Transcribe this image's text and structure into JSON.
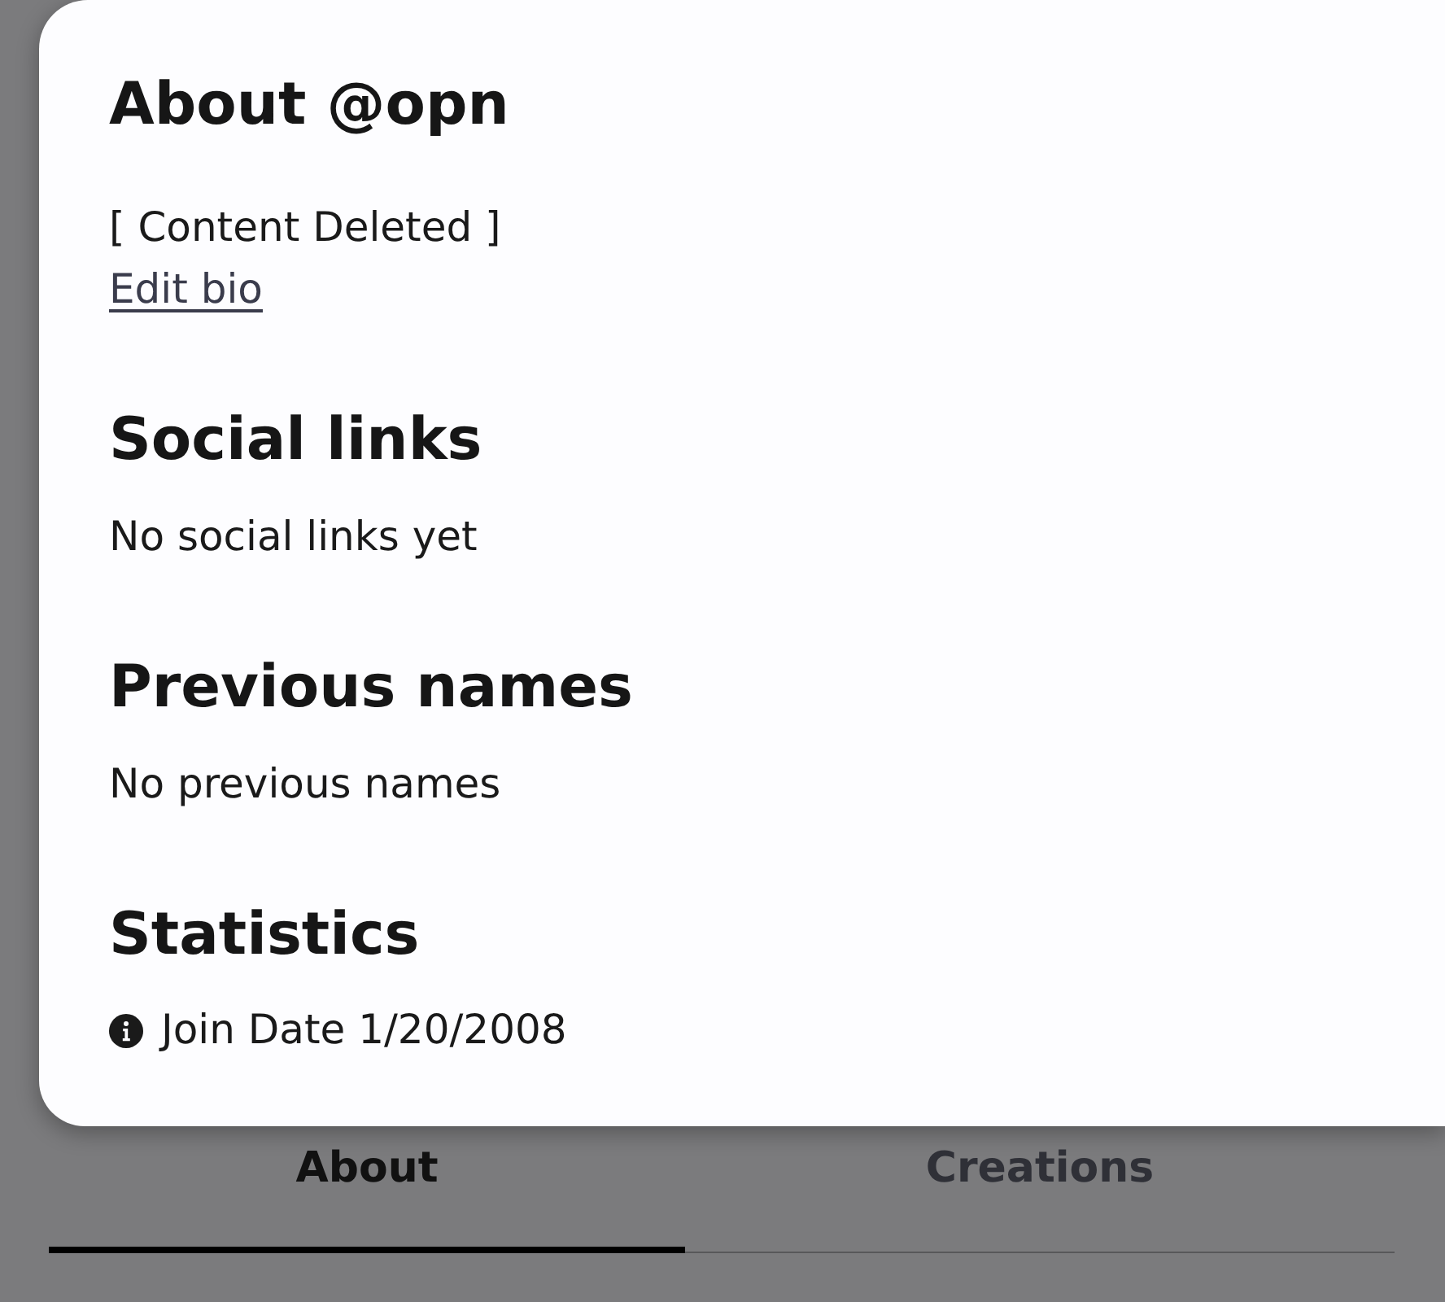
{
  "profile_panel": {
    "title": "About @opn",
    "bio": "[ Content Deleted ]",
    "edit_link": "Edit bio",
    "sections": [
      {
        "kind": "text",
        "heading": "Social links",
        "text": "No social links yet"
      },
      {
        "kind": "text",
        "heading": "Previous names",
        "text": "No previous names"
      },
      {
        "kind": "stats",
        "heading": "Statistics",
        "items": [
          {
            "kind": "info",
            "text": "Join Date 1/20/2008"
          }
        ]
      }
    ]
  },
  "tabs": [
    {
      "label": "About",
      "selected": true
    },
    {
      "label": "Creations",
      "selected": false
    }
  ]
}
